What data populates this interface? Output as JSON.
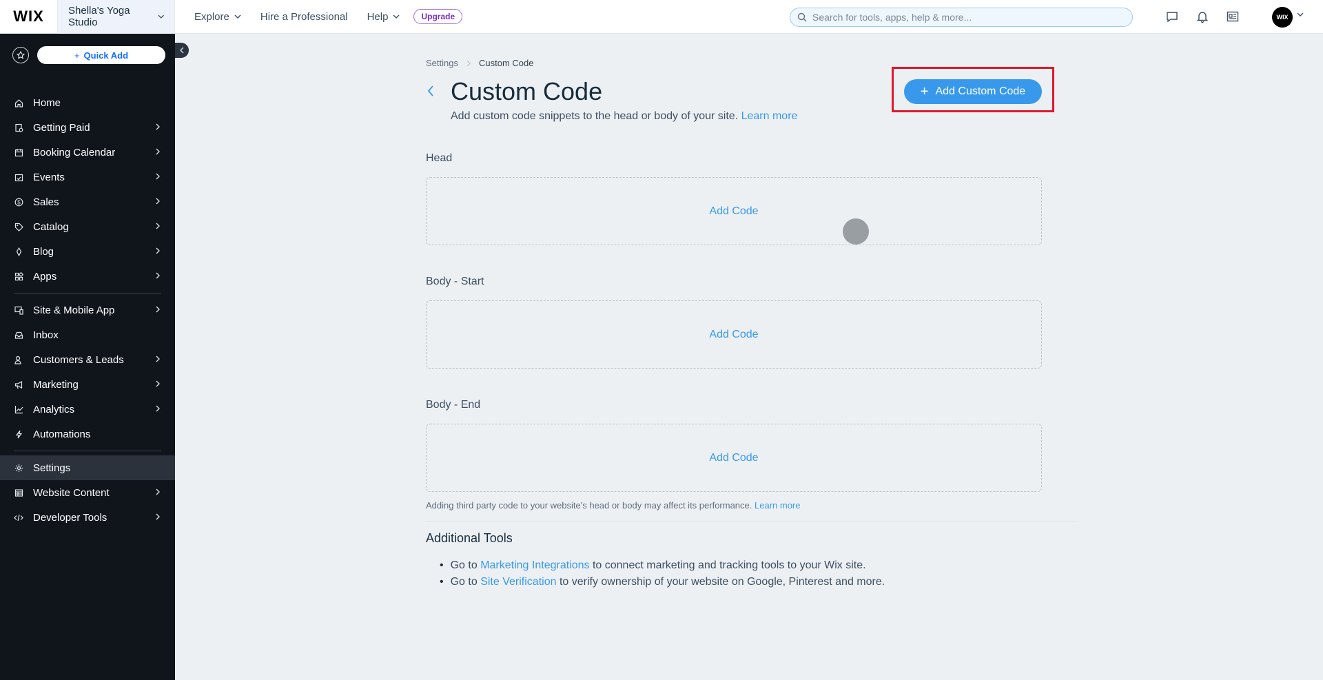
{
  "topbar": {
    "logo": "WIX",
    "site_name": "Shella's Yoga Studio",
    "nav": [
      {
        "label": "Explore",
        "has_dropdown": true
      },
      {
        "label": "Hire a Professional",
        "has_dropdown": false
      },
      {
        "label": "Help",
        "has_dropdown": true
      }
    ],
    "upgrade_label": "Upgrade",
    "search_placeholder": "Search for tools, apps, help & more...",
    "avatar_text": "WIX"
  },
  "sidebar": {
    "quick_add_label": "Quick Add",
    "items": [
      {
        "label": "Home",
        "icon": "home-icon",
        "chevron": false
      },
      {
        "label": "Getting Paid",
        "icon": "payment-icon",
        "chevron": true
      },
      {
        "label": "Booking Calendar",
        "icon": "calendar-icon",
        "chevron": true
      },
      {
        "label": "Events",
        "icon": "events-icon",
        "chevron": true
      },
      {
        "label": "Sales",
        "icon": "dollar-icon",
        "chevron": true
      },
      {
        "label": "Catalog",
        "icon": "tag-icon",
        "chevron": true
      },
      {
        "label": "Blog",
        "icon": "pen-icon",
        "chevron": true
      },
      {
        "label": "Apps",
        "icon": "apps-icon",
        "chevron": true
      },
      {
        "label": "Site & Mobile App",
        "icon": "devices-icon",
        "chevron": true
      },
      {
        "label": "Inbox",
        "icon": "inbox-icon",
        "chevron": false
      },
      {
        "label": "Customers & Leads",
        "icon": "people-icon",
        "chevron": true
      },
      {
        "label": "Marketing",
        "icon": "megaphone-icon",
        "chevron": true
      },
      {
        "label": "Analytics",
        "icon": "chart-icon",
        "chevron": true
      },
      {
        "label": "Automations",
        "icon": "bolt-icon",
        "chevron": false
      },
      {
        "label": "Settings",
        "icon": "gear-icon",
        "chevron": false,
        "active": true
      },
      {
        "label": "Website Content",
        "icon": "table-icon",
        "chevron": true
      },
      {
        "label": "Developer Tools",
        "icon": "code-icon",
        "chevron": true
      }
    ]
  },
  "main": {
    "breadcrumb": [
      "Settings",
      "Custom Code"
    ],
    "title": "Custom Code",
    "subtitle": "Add custom code snippets to the head or body of your site.",
    "subtitle_link": "Learn more",
    "add_custom_code_label": "Add Custom Code",
    "sections": [
      {
        "label": "Head",
        "action": "Add Code"
      },
      {
        "label": "Body - Start",
        "action": "Add Code"
      },
      {
        "label": "Body - End",
        "action": "Add Code"
      }
    ],
    "note": "Adding third party code to your website's head or body may affect its performance.",
    "note_link": "Learn more",
    "additional_tools_title": "Additional Tools",
    "tools": [
      {
        "prefix": "Go to",
        "link": "Marketing Integrations",
        "suffix": "to connect marketing and tracking tools to your Wix site."
      },
      {
        "prefix": "Go to",
        "link": "Site Verification",
        "suffix": "to verify ownership of your website on Google, Pinterest and more."
      }
    ]
  },
  "colors": {
    "accent": "#3899ec",
    "highlight": "#e0182b",
    "sidebar_bg": "#10151c"
  }
}
